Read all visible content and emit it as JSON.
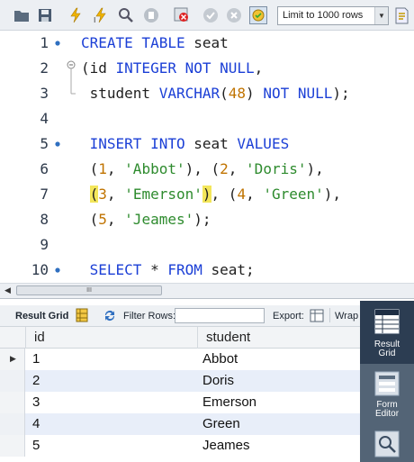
{
  "toolbar": {
    "limit_select": "Limit to 1000 rows",
    "icons": [
      "open-folder-icon",
      "save-icon",
      "execute-icon",
      "execute-current-icon",
      "explain-icon",
      "stop-icon",
      "toggle-error-icon",
      "commit-icon",
      "rollback-icon",
      "autocommit-icon",
      "beautify-icon"
    ]
  },
  "editor": {
    "lines": [
      {
        "num": "1",
        "tokens": [
          {
            "t": "CREATE TABLE ",
            "c": "kw"
          },
          {
            "t": "seat",
            "c": ""
          }
        ],
        "marker": "dot"
      },
      {
        "num": "2",
        "tokens": [
          {
            "t": "(id ",
            "c": ""
          },
          {
            "t": "INTEGER NOT NULL",
            "c": "kw"
          },
          {
            "t": ",",
            "c": ""
          }
        ],
        "marker": "fold-open"
      },
      {
        "num": "3",
        "tokens": [
          {
            "t": " student ",
            "c": ""
          },
          {
            "t": "VARCHAR",
            "c": "kw"
          },
          {
            "t": "(",
            "c": ""
          },
          {
            "t": "48",
            "c": "num"
          },
          {
            "t": ") ",
            "c": ""
          },
          {
            "t": "NOT NULL",
            "c": "kw"
          },
          {
            "t": ");",
            "c": ""
          }
        ],
        "marker": "fold-end"
      },
      {
        "num": "4",
        "tokens": [],
        "marker": ""
      },
      {
        "num": "5",
        "tokens": [
          {
            "t": " INSERT INTO ",
            "c": "kw"
          },
          {
            "t": "seat ",
            "c": ""
          },
          {
            "t": "VALUES",
            "c": "kw"
          }
        ],
        "marker": "dot"
      },
      {
        "num": "6",
        "tokens": [
          {
            "t": " (",
            "c": ""
          },
          {
            "t": "1",
            "c": "num"
          },
          {
            "t": ", ",
            "c": ""
          },
          {
            "t": "'Abbot'",
            "c": "str"
          },
          {
            "t": "), (",
            "c": ""
          },
          {
            "t": "2",
            "c": "num"
          },
          {
            "t": ", ",
            "c": ""
          },
          {
            "t": "'Doris'",
            "c": "str"
          },
          {
            "t": "),",
            "c": ""
          }
        ],
        "marker": ""
      },
      {
        "num": "7",
        "tokens": [
          {
            "t": " ",
            "c": ""
          },
          {
            "t": "(",
            "c": "hl"
          },
          {
            "t": "3",
            "c": "num"
          },
          {
            "t": ", ",
            "c": ""
          },
          {
            "t": "'Emerson'",
            "c": "str"
          },
          {
            "t": ")",
            "c": "hl"
          },
          {
            "t": ", (",
            "c": ""
          },
          {
            "t": "4",
            "c": "num"
          },
          {
            "t": ", ",
            "c": ""
          },
          {
            "t": "'Green'",
            "c": "str"
          },
          {
            "t": "),",
            "c": ""
          }
        ],
        "marker": ""
      },
      {
        "num": "8",
        "tokens": [
          {
            "t": " (",
            "c": ""
          },
          {
            "t": "5",
            "c": "num"
          },
          {
            "t": ", ",
            "c": ""
          },
          {
            "t": "'Jeames'",
            "c": "str"
          },
          {
            "t": ");",
            "c": ""
          }
        ],
        "marker": ""
      },
      {
        "num": "9",
        "tokens": [],
        "marker": ""
      },
      {
        "num": "10",
        "tokens": [
          {
            "t": " SELECT ",
            "c": "kw"
          },
          {
            "t": "* ",
            "c": ""
          },
          {
            "t": "FROM ",
            "c": "kw"
          },
          {
            "t": "seat;",
            "c": ""
          }
        ],
        "marker": "dot"
      }
    ]
  },
  "hscroll": {
    "thumb_label": "III"
  },
  "result_toolbar": {
    "result_grid_label": "Result Grid",
    "filter_rows_label": "Filter Rows:",
    "filter_value": "",
    "export_label": "Export:",
    "wrap_label": "Wrap"
  },
  "grid": {
    "columns": [
      "id",
      "student"
    ],
    "rows": [
      [
        "1",
        "Abbot"
      ],
      [
        "2",
        "Doris"
      ],
      [
        "3",
        "Emerson"
      ],
      [
        "4",
        "Green"
      ],
      [
        "5",
        "Jeames"
      ]
    ]
  },
  "side_panel": {
    "items": [
      {
        "line1": "Result",
        "line2": "Grid",
        "active": true
      },
      {
        "line1": "Form",
        "line2": "Editor",
        "active": false
      },
      {
        "line1": "",
        "line2": "",
        "active": false
      }
    ]
  },
  "colors": {
    "keyword": "#1b3fd6",
    "string": "#2e8b2e",
    "number": "#c07300",
    "bracket_highlight": "#f3e65a",
    "side_panel": "#536476"
  }
}
